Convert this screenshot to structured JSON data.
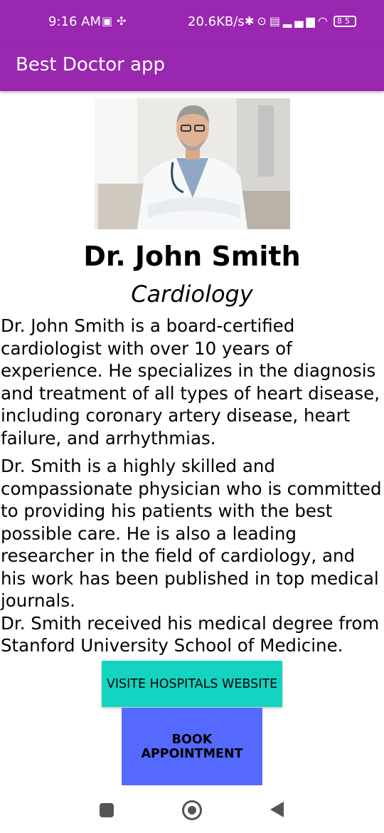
{
  "status_bar": {
    "time": "9:16 AM",
    "speed": "20.6KB/s",
    "battery": "85"
  },
  "app_bar": {
    "title": "Best Doctor app"
  },
  "doctor": {
    "name": "Dr. John Smith",
    "specialty": "Cardiology",
    "bio_paragraph_1": "Dr. John Smith is a board-certified cardiologist with over 10 years of experience. He specializes in the diagnosis and treatment of all types of heart disease, including coronary artery disease, heart failure, and arrhythmias.",
    "bio_paragraph_2": "Dr. Smith is a highly skilled and compassionate physician who is committed to providing his patients with the best possible care. He is also a leading researcher in the field of cardiology, and his work has been published in top medical journals.\n Dr. Smith received his medical degree from Stanford University School of Medicine."
  },
  "buttons": {
    "website": "VISITE HOSPITALS WEBSITE",
    "book": "BOOK APPOINTMENT"
  },
  "colors": {
    "app_bar": "#9a27b0",
    "website_button": "#12d4c0",
    "book_button": "#5569ff"
  }
}
